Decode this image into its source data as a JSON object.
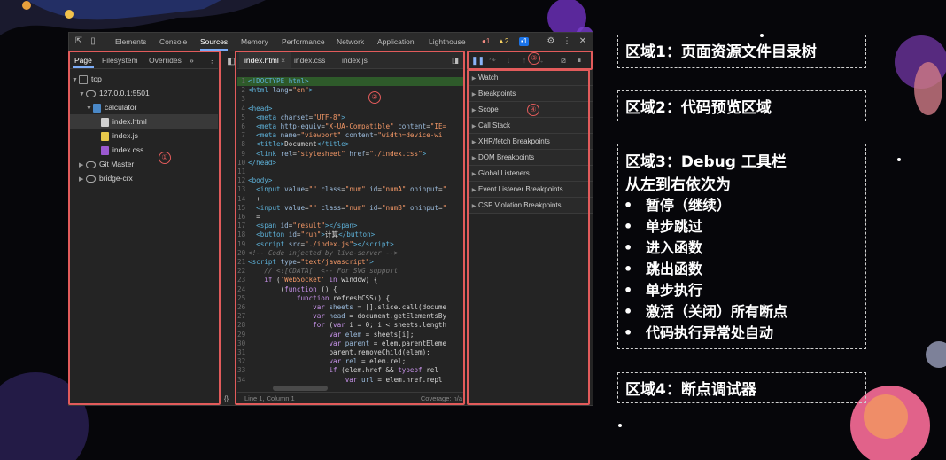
{
  "devtools": {
    "tabs": [
      "Elements",
      "Console",
      "Sources",
      "Memory",
      "Performance",
      "Network",
      "Application",
      "Lighthouse"
    ],
    "active_tab": "Sources",
    "error_count": "1",
    "warning_count": "2",
    "message_count": "1"
  },
  "navigator": {
    "tabs": [
      "Page",
      "Filesystem",
      "Overrides"
    ],
    "more": "»",
    "tree": [
      {
        "label": "top"
      },
      {
        "label": "127.0.0.1:5501"
      },
      {
        "label": "calculator"
      },
      {
        "label": "index.html"
      },
      {
        "label": "index.js"
      },
      {
        "label": "index.css"
      },
      {
        "label": "Git Master"
      },
      {
        "label": "bridge-crx"
      }
    ]
  },
  "editor": {
    "tabs": [
      "index.html",
      "index.css",
      "index.js"
    ],
    "close": "×",
    "status_left": "Line 1, Column 1",
    "status_right": "Coverage: n/a",
    "format_button": "{}"
  },
  "debugger": {
    "sections": [
      "Watch",
      "Breakpoints",
      "Scope",
      "Call Stack",
      "XHR/fetch Breakpoints",
      "DOM Breakpoints",
      "Global Listeners",
      "Event Listener Breakpoints",
      "CSP Violation Breakpoints"
    ]
  },
  "markers": [
    "①",
    "②",
    "③",
    "④"
  ],
  "notes": {
    "area1": "区域1：页面资源文件目录树",
    "area2": "区域2：代码预览区域",
    "area3_title": "区域3：Debug 工具栏",
    "area3_subtitle": "从左到右依次为",
    "area3_items": [
      "暂停（继续）",
      "单步跳过",
      "进入函数",
      "跳出函数",
      "单步执行",
      "激活（关闭）所有断点",
      "代码执行异常处自动"
    ],
    "area4": "区域4：断点调试器"
  }
}
